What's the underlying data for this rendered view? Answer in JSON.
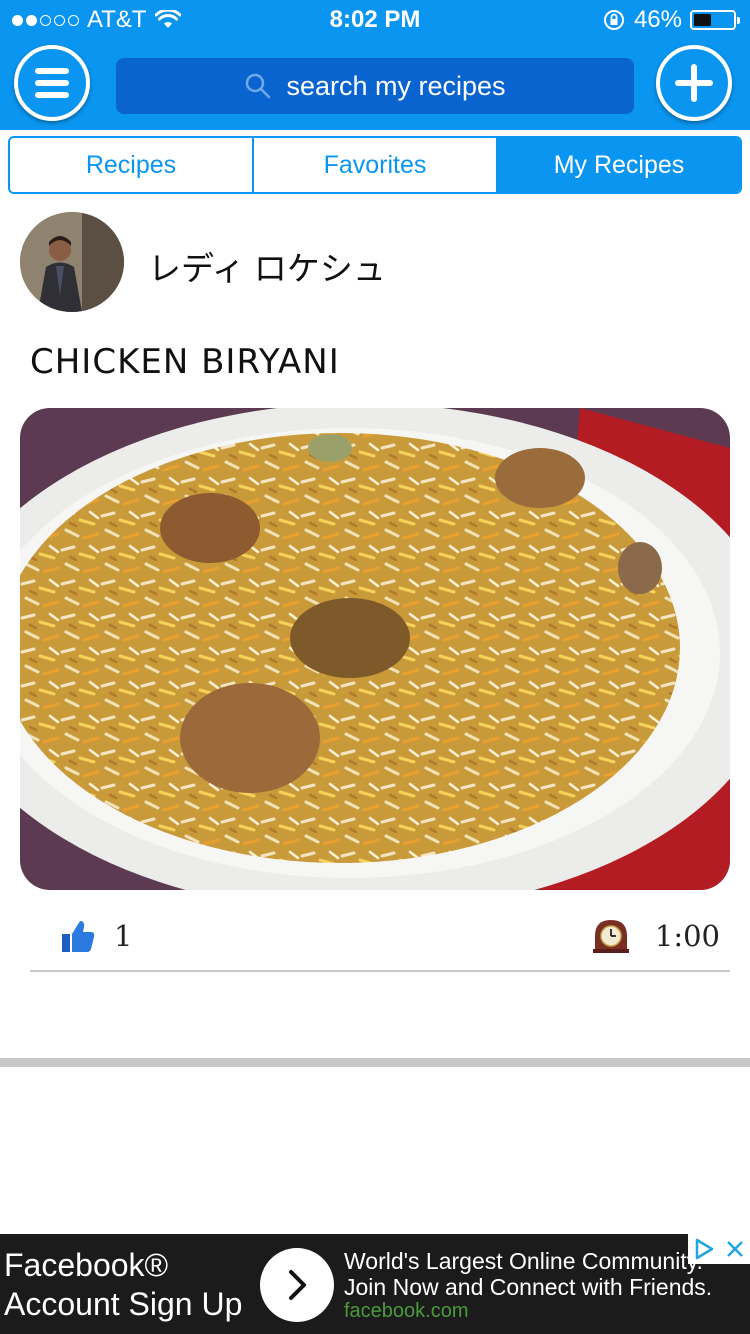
{
  "status_bar": {
    "carrier": "AT&T",
    "time": "8:02 PM",
    "battery": "46%",
    "battery_level": 0.46,
    "signal_bars": 2,
    "signal_total": 5
  },
  "header": {
    "menu_icon": "hamburger-menu-icon",
    "add_icon": "plus-icon",
    "search_placeholder": "search my recipes"
  },
  "tabs": [
    {
      "label": "Recipes",
      "active": false
    },
    {
      "label": "Favorites",
      "active": false
    },
    {
      "label": "My Recipes",
      "active": true
    }
  ],
  "recipe": {
    "author_name": "レディ ロケシュ",
    "title": "CHICKEN BIRYANI",
    "likes": "1",
    "cook_time": "1:00"
  },
  "ad": {
    "title": "Facebook® Account Sign Up",
    "body": "World's Largest Online Community. Join Now and Connect with Friends.",
    "domain": "facebook.com"
  },
  "colors": {
    "primary": "#0a96f0",
    "search_bg": "#0a64d0",
    "ad_bg": "#1b1b1b"
  }
}
